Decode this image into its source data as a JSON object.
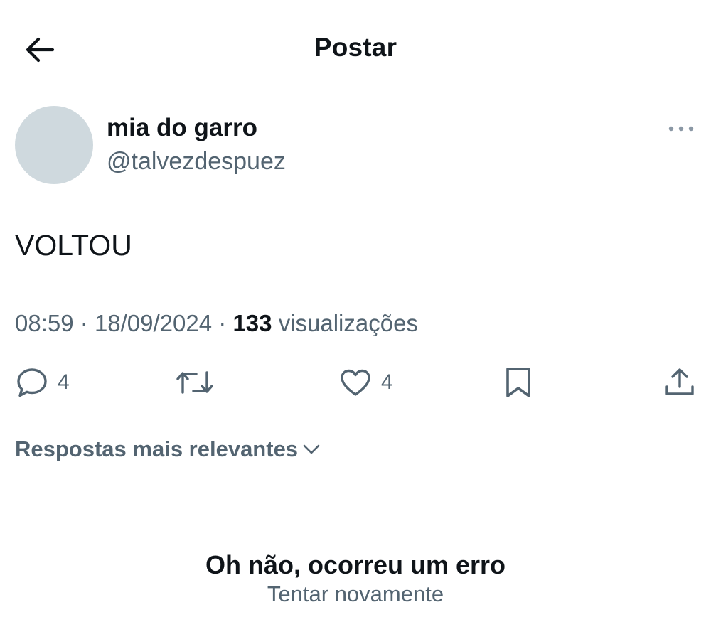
{
  "header": {
    "title": "Postar"
  },
  "post": {
    "author_name": "mia do garro",
    "author_handle": "@talvezdespuez",
    "text": "VOLTOU",
    "time": "08:59",
    "date": "18/09/2024",
    "views_count": "133",
    "views_label": "visualizações",
    "separator": "·"
  },
  "actions": {
    "reply_count": "4",
    "like_count": "4"
  },
  "replies": {
    "sort_label": "Respostas mais relevantes"
  },
  "error": {
    "title": "Oh não, ocorreu um erro",
    "retry_label": "Tentar novamente"
  },
  "colors": {
    "text": "#0f1419",
    "secondary": "#536471",
    "avatar": "#cfd9de"
  }
}
